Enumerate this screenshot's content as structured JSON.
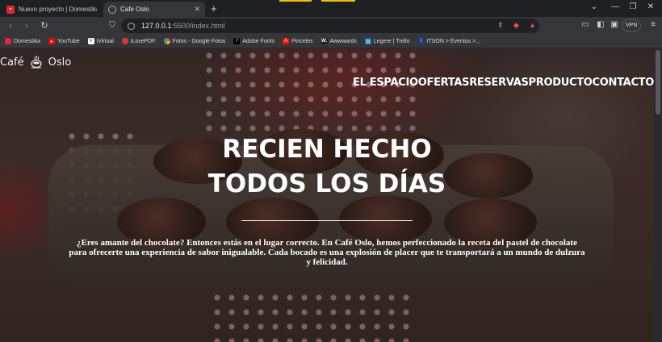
{
  "browser": {
    "tabs": [
      {
        "title": "Nuevo proyecto | Domestika",
        "active": false
      },
      {
        "title": "Cafe Oslo",
        "active": true
      }
    ],
    "url_host": "127.0.0.1",
    "url_path": ":5500/index.html",
    "vpn_label": "VPN",
    "bookmarks": [
      {
        "label": "Domestika",
        "icon": "domestika-icon",
        "color": "#e0282e"
      },
      {
        "label": "YouTube",
        "icon": "youtube-icon",
        "color": "#ff0000"
      },
      {
        "label": "iVirtual",
        "icon": "ivirtual-icon",
        "color": "#ffffff"
      },
      {
        "label": "iLovePDF",
        "icon": "ilovepdf-icon",
        "color": "#e5322d"
      },
      {
        "label": "Fotos - Google Fotos",
        "icon": "google-photos-icon",
        "color": "#fbbc04"
      },
      {
        "label": "Adobe Fonts",
        "icon": "adobe-fonts-icon",
        "color": "#000000"
      },
      {
        "label": "Pinceles",
        "icon": "adobe-icon",
        "color": "#fa0f00"
      },
      {
        "label": "Awwwards",
        "icon": "awwwards-icon",
        "color": "#222222"
      },
      {
        "label": "Legere | Trello",
        "icon": "trello-icon",
        "color": "#0079bf"
      },
      {
        "label": "ITSON > Eventos >...",
        "icon": "itson-icon",
        "color": "#1a3a8a"
      }
    ]
  },
  "site": {
    "brand_left": "Café",
    "brand_right": "Oslo",
    "nav": [
      "EL ESPACIO",
      "OFERTAS",
      "RESERVAS",
      "PRODUCTO",
      "CONTACTO"
    ],
    "hero_line1": "RECIEN HECHO",
    "hero_line2": "TODOS LOS DÍAS",
    "hero_text": "¿Eres amante del chocolate? Entonces estás en el lugar correcto. En Café Oslo, hemos perfeccionado la receta del pastel de chocolate para ofrecerte una experiencia de sabor inigualable. Cada bocado es una explosión de placer que te transportará a un mundo de dulzura y felicidad."
  }
}
